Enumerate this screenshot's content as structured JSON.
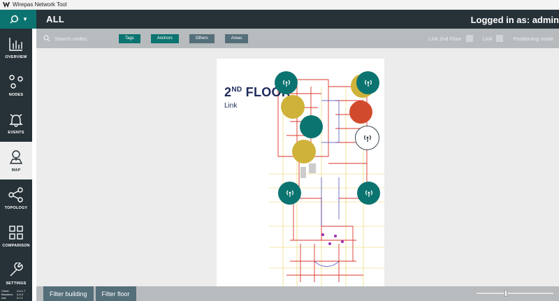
{
  "window": {
    "title": "Wirepas Network Tool"
  },
  "header": {
    "page_title": "ALL",
    "login_text": "Logged in as:  admin"
  },
  "sidebar": {
    "items": [
      {
        "label": "OVERVIEW",
        "icon": "bar-chart-icon"
      },
      {
        "label": "NODES",
        "icon": "nodes-icon"
      },
      {
        "label": "EVENTS",
        "icon": "bell-icon"
      },
      {
        "label": "MAP",
        "icon": "map-pin-icon",
        "active": true
      },
      {
        "label": "TOPOLOGY",
        "icon": "share-icon"
      },
      {
        "label": "COMPARISON",
        "icon": "grid-icon"
      },
      {
        "label": "SETTINGS",
        "icon": "wrench-icon"
      }
    ]
  },
  "versions": [
    {
      "key": "Client:",
      "value": "4.4.1.7"
    },
    {
      "key": "Backend:",
      "value": "4.4.3"
    },
    {
      "key": "wnt:",
      "value": "3.7.1"
    }
  ],
  "toolbar": {
    "search_placeholder": "Search nodes",
    "filters": [
      {
        "label": "Tags",
        "style": "teal"
      },
      {
        "label": "Anchors",
        "style": "teal"
      },
      {
        "label": "Others",
        "style": "gray"
      },
      {
        "label": "Areas",
        "style": "gray"
      }
    ],
    "floor_link_label": "Link 2nd Floor",
    "link_label": "Link",
    "positioning_label": "Positioning mode"
  },
  "floorplan": {
    "title_main": "2",
    "title_sup": "ND",
    "title_rest": " FLOOR",
    "subtitle": "Link"
  },
  "nodes": [
    {
      "kind": "anchor",
      "color": "#0c7470"
    },
    {
      "kind": "tag",
      "color": "#cfb23a"
    },
    {
      "kind": "anchor",
      "color": "#0c7470"
    },
    {
      "kind": "tag",
      "color": "#cfb23a"
    },
    {
      "kind": "tag",
      "color": "#d24a2c"
    },
    {
      "kind": "tag",
      "color": "#0c7470"
    },
    {
      "kind": "anchor-selected",
      "color": "#ffffff"
    },
    {
      "kind": "tag",
      "color": "#cfb23a"
    },
    {
      "kind": "anchor",
      "color": "#0c7470"
    },
    {
      "kind": "anchor",
      "color": "#0c7470"
    }
  ],
  "bottom": {
    "filter_building": "Filter building",
    "filter_floor": "Filter floor",
    "zoom_level": 0.38
  },
  "colors": {
    "teal": "#0c7470",
    "dark": "#263238",
    "toolbar": "#b7bbbd",
    "button_gray": "#546e7a"
  }
}
